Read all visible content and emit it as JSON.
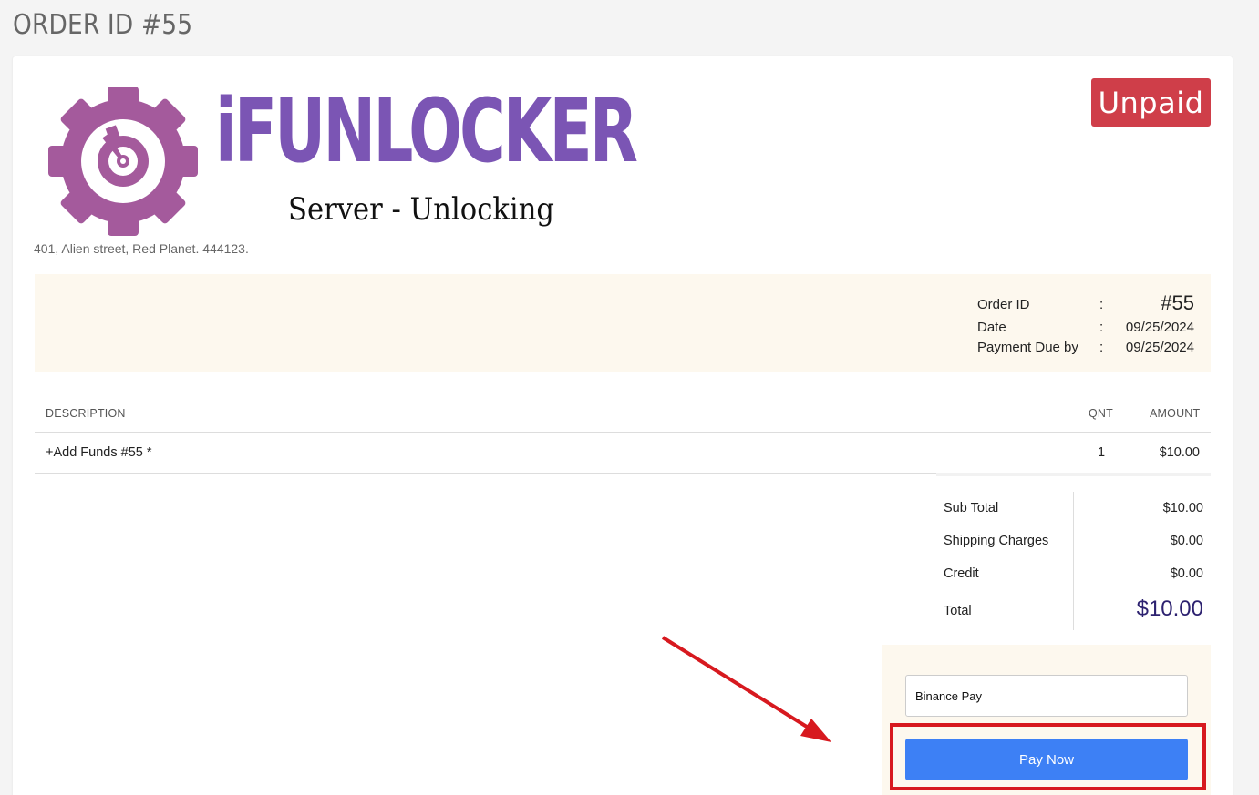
{
  "page": {
    "title": "ORDER ID #55"
  },
  "brand": {
    "name": "iFUNLOCKER",
    "tagline": "Server - Unlocking",
    "address": "401, Alien street, Red Planet. 444123.",
    "logo_icon": "gear-icon",
    "colors": {
      "gear": "#a45a9c",
      "wordmark": "#7b55b4"
    }
  },
  "status": {
    "label": "Unpaid",
    "color": "#cf3e49"
  },
  "meta": {
    "order_id_label": "Order ID",
    "order_id_value": "#55",
    "date_label": "Date",
    "date_value": "09/25/2024",
    "due_label": "Payment Due by",
    "due_value": "09/25/2024",
    "separator": ":"
  },
  "table": {
    "headers": {
      "description": "DESCRIPTION",
      "qnt": "QNT",
      "amount": "AMOUNT"
    },
    "rows": [
      {
        "description": "+Add Funds #55 *",
        "qnt": "1",
        "amount": "$10.00"
      }
    ]
  },
  "totals": {
    "sub_total_label": "Sub Total",
    "sub_total_value": "$10.00",
    "shipping_label": "Shipping Charges",
    "shipping_value": "$0.00",
    "credit_label": "Credit",
    "credit_value": "$0.00",
    "total_label": "Total",
    "total_value": "$10.00"
  },
  "payment": {
    "method": "Binance Pay",
    "pay_button_label": "Pay Now",
    "button_color": "#3d80f5"
  },
  "annotation": {
    "highlight_color": "#d7191f"
  }
}
